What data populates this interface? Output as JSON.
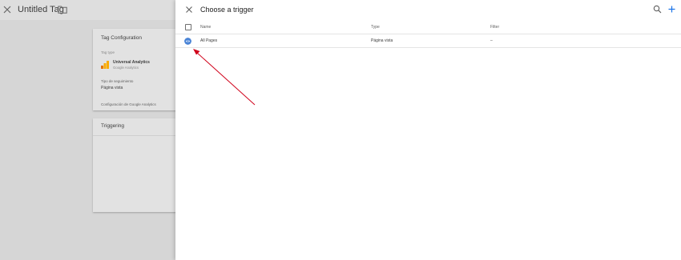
{
  "editor": {
    "title": "Untitled Tag",
    "config_card": {
      "title": "Tag Configuration",
      "tag_type_label": "Tag type",
      "tag_type_name": "Universal Analytics",
      "tag_type_vendor": "Google Analytics",
      "tracking_type_label": "Tipo de seguimiento",
      "tracking_type_value": "Página vista",
      "settings_label": "Configuración de Google Analytics"
    },
    "triggering_card": {
      "title": "Triggering"
    }
  },
  "panel": {
    "title": "Choose a trigger",
    "columns": [
      "Name",
      "Type",
      "Filter"
    ],
    "rows": [
      {
        "name": "All Pages",
        "type": "Página vista",
        "filter": "–"
      }
    ]
  },
  "colors": {
    "trigger_icon": "#4a84d6",
    "annotation_arrow": "#d0021b",
    "ga_orange": "#f9ab00",
    "ga_dark_orange": "#e37400"
  }
}
